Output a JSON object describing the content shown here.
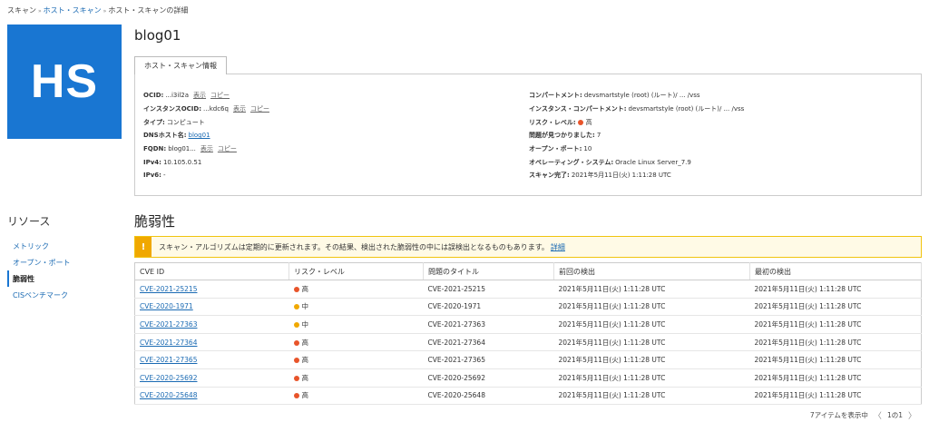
{
  "breadcrumb": [
    {
      "label": "スキャン",
      "link": false
    },
    {
      "label": "ホスト・スキャン",
      "link": true
    },
    {
      "label": "ホスト・スキャンの詳細",
      "link": false
    }
  ],
  "tile": {
    "initials": "HS",
    "color": "#1976d2"
  },
  "title": "blog01",
  "tab_label": "ホスト・スキャン情報",
  "info_left": [
    {
      "key": "OCID:",
      "value": "...i3il2a",
      "links": [
        "表示",
        "コピー"
      ]
    },
    {
      "key": "インスタンスOCID:",
      "value": "...kdc6q",
      "links": [
        "表示",
        "コピー"
      ]
    },
    {
      "key": "タイプ:",
      "value": "コンピュート",
      "links": []
    },
    {
      "key": "DNSホスト名:",
      "value": "",
      "link_value": "blog01",
      "links": []
    },
    {
      "key": "FQDN:",
      "value": "blog01...",
      "links": [
        "表示",
        "コピー"
      ]
    },
    {
      "key": "IPv4:",
      "value": "10.105.0.51",
      "links": []
    },
    {
      "key": "IPv6:",
      "value": "-",
      "links": []
    }
  ],
  "info_right": [
    {
      "key": "コンパートメント:",
      "value": "devsmartstyle (root) (ルート)/ ... /vss"
    },
    {
      "key": "インスタンス・コンパートメント:",
      "value": "devsmartstyle (root) (ルート)/ ... /vss"
    },
    {
      "key": "リスク・レベル:",
      "value": "高",
      "dot": "#e8542a"
    },
    {
      "key": "問題が見つかりました:",
      "value": "7"
    },
    {
      "key": "オープン・ポート:",
      "value": "10"
    },
    {
      "key": "オペレーティング・システム:",
      "value": "Oracle Linux Server_7.9"
    },
    {
      "key": "スキャン完了:",
      "value": "2021年5月11日(火) 1:11:28 UTC"
    }
  ],
  "sidebar": {
    "title": "リソース",
    "items": [
      {
        "label": "メトリック",
        "active": false
      },
      {
        "label": "オープン・ポート",
        "active": false
      },
      {
        "label": "脆弱性",
        "active": true
      },
      {
        "label": "CISベンチマーク",
        "active": false
      }
    ]
  },
  "section_title": "脆弱性",
  "alert": {
    "text": "スキャン・アルゴリズムは定期的に更新されます。その結果、検出された脆弱性の中には誤検出となるものもあります。",
    "link": "詳細",
    "icon": "!"
  },
  "table": {
    "headers": [
      "CVE ID",
      "リスク・レベル",
      "問題のタイトル",
      "前回の検出",
      "最初の検出"
    ],
    "rows": [
      {
        "cve": "CVE-2021-25215",
        "risk": "高",
        "risk_color": "#e8542a",
        "title": "CVE-2021-25215",
        "last": "2021年5月11日(火) 1:11:28 UTC",
        "first": "2021年5月11日(火) 1:11:28 UTC"
      },
      {
        "cve": "CVE-2020-1971",
        "risk": "中",
        "risk_color": "#f0a800",
        "title": "CVE-2020-1971",
        "last": "2021年5月11日(火) 1:11:28 UTC",
        "first": "2021年5月11日(火) 1:11:28 UTC"
      },
      {
        "cve": "CVE-2021-27363",
        "risk": "中",
        "risk_color": "#f0a800",
        "title": "CVE-2021-27363",
        "last": "2021年5月11日(火) 1:11:28 UTC",
        "first": "2021年5月11日(火) 1:11:28 UTC"
      },
      {
        "cve": "CVE-2021-27364",
        "risk": "高",
        "risk_color": "#e8542a",
        "title": "CVE-2021-27364",
        "last": "2021年5月11日(火) 1:11:28 UTC",
        "first": "2021年5月11日(火) 1:11:28 UTC"
      },
      {
        "cve": "CVE-2021-27365",
        "risk": "高",
        "risk_color": "#e8542a",
        "title": "CVE-2021-27365",
        "last": "2021年5月11日(火) 1:11:28 UTC",
        "first": "2021年5月11日(火) 1:11:28 UTC"
      },
      {
        "cve": "CVE-2020-25692",
        "risk": "高",
        "risk_color": "#e8542a",
        "title": "CVE-2020-25692",
        "last": "2021年5月11日(火) 1:11:28 UTC",
        "first": "2021年5月11日(火) 1:11:28 UTC"
      },
      {
        "cve": "CVE-2020-25648",
        "risk": "高",
        "risk_color": "#e8542a",
        "title": "CVE-2020-25648",
        "last": "2021年5月11日(火) 1:11:28 UTC",
        "first": "2021年5月11日(火) 1:11:28 UTC"
      }
    ]
  },
  "pager": {
    "summary": "7アイテムを表示中",
    "page": "1の1",
    "prev": "〈",
    "next": "〉"
  }
}
